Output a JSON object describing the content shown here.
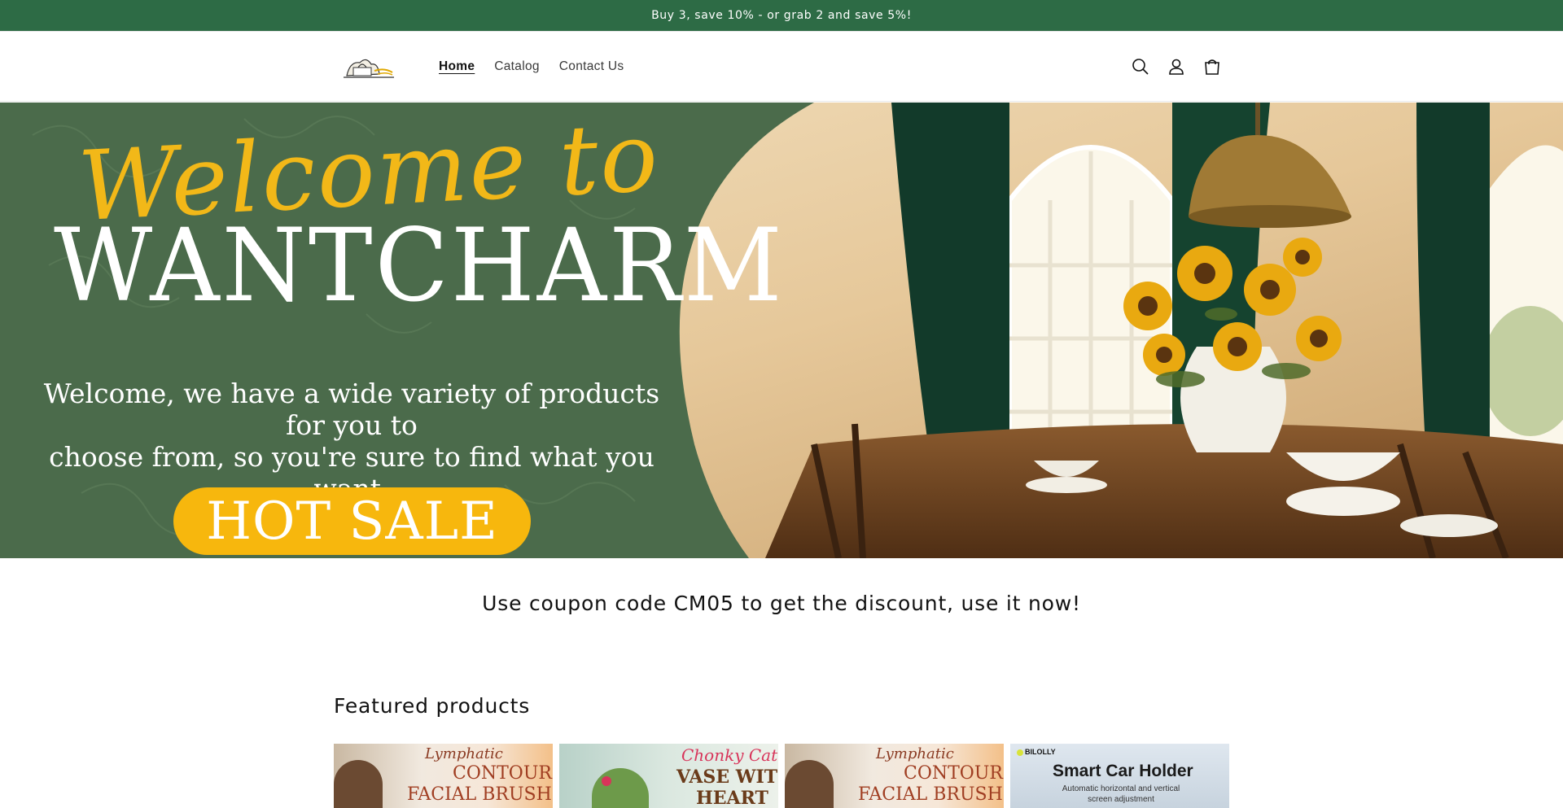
{
  "announcement": {
    "text": "Buy 3, save 10% - or grab 2 and save 5%!"
  },
  "header": {
    "nav": [
      {
        "label": "Home",
        "active": true
      },
      {
        "label": "Catalog",
        "active": false
      },
      {
        "label": "Contact Us",
        "active": false
      }
    ],
    "icons": [
      "search-icon",
      "account-icon",
      "cart-icon"
    ]
  },
  "hero": {
    "script_text": "Welcome to",
    "brand": "WANTCHARM",
    "subtitle_line1": "Welcome, we have a wide variety of products for you to",
    "subtitle_line2": "choose from, so you're sure to find what you want.",
    "cta": "HOT SALE"
  },
  "coupon": {
    "text": "Use coupon code CM05 to get the discount, use it now!"
  },
  "featured": {
    "heading": "Featured products",
    "products": [
      {
        "line1": "Lymphatic",
        "line2": "CONTOUR",
        "line3": "FACIAL BRUSH"
      },
      {
        "line1": "Chonky Cat",
        "line2": "VASE WITH",
        "line3": "HEART"
      },
      {
        "line1": "Lymphatic",
        "line2": "CONTOUR",
        "line3": "FACIAL BRUSH"
      },
      {
        "brand": "BILOLLY",
        "title": "Smart Car Holder",
        "sub1": "Automatic horizontal and vertical",
        "sub2": "screen adjustment"
      }
    ]
  },
  "colors": {
    "announcement_bg": "#2d6b45",
    "hero_green": "#4c6b4c",
    "accent_yellow": "#f7b70d"
  }
}
